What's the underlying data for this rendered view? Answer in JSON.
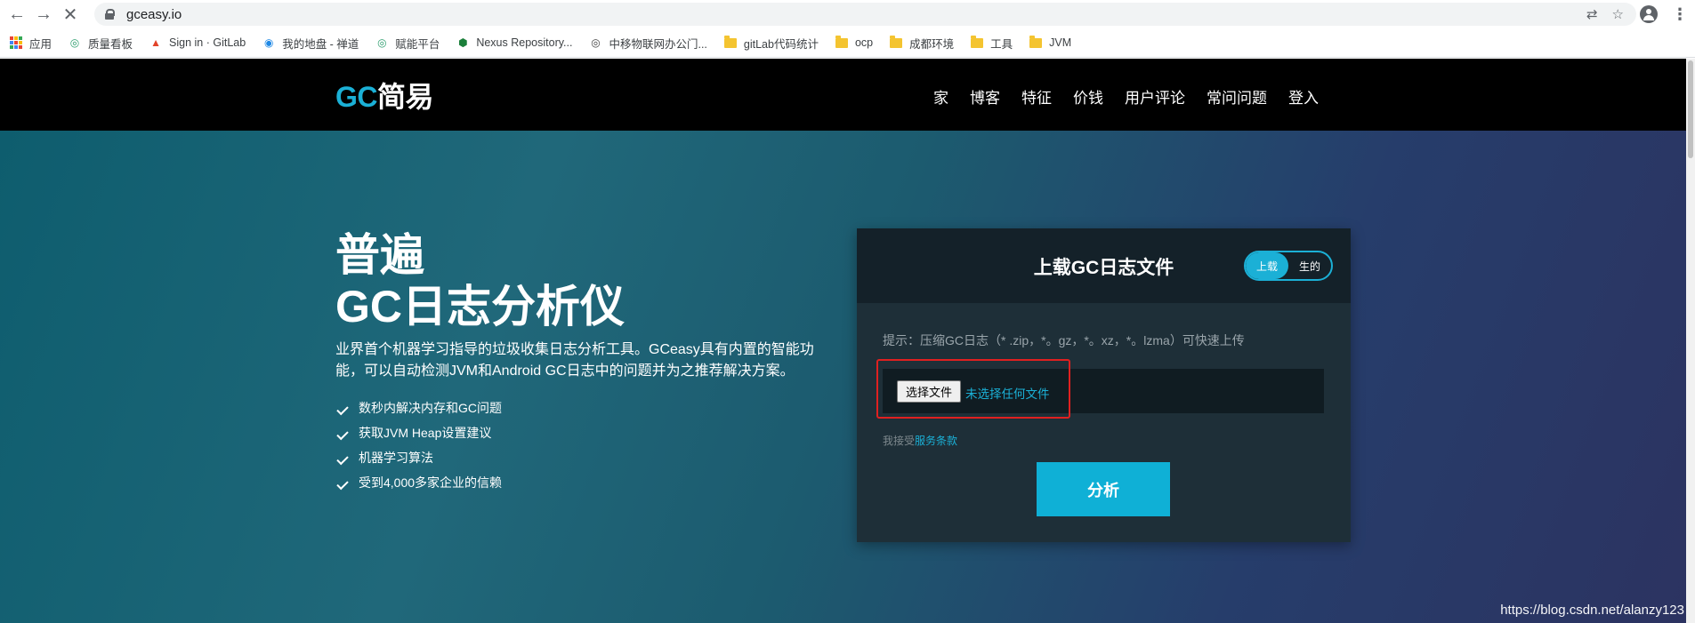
{
  "browser": {
    "url": "gceasy.io",
    "bookmarks": [
      {
        "label": "应用",
        "icon": "apps-grid-icon"
      },
      {
        "label": "质量看板",
        "icon": "globe-icon"
      },
      {
        "label": "Sign in · GitLab",
        "icon": "gitlab-icon"
      },
      {
        "label": "我的地盘 - 禅道",
        "icon": "zentao-icon"
      },
      {
        "label": "赋能平台",
        "icon": "globe-icon"
      },
      {
        "label": "Nexus Repository...",
        "icon": "nexus-icon"
      },
      {
        "label": "中移物联网办公门...",
        "icon": "globe-icon"
      },
      {
        "label": "gitLab代码统计",
        "icon": "folder-icon"
      },
      {
        "label": "ocp",
        "icon": "folder-icon"
      },
      {
        "label": "成都环境",
        "icon": "folder-icon"
      },
      {
        "label": "工具",
        "icon": "folder-icon"
      },
      {
        "label": "JVM",
        "icon": "folder-icon"
      }
    ]
  },
  "site": {
    "logo_gc": "GC",
    "logo_cn": "简易",
    "nav": [
      "家",
      "博客",
      "特征",
      "价钱",
      "用户评论",
      "常问问题",
      "登入"
    ]
  },
  "hero": {
    "title_line1": "普遍",
    "title_line2": "GC日志分析仪",
    "description": "业界首个机器学习指导的垃圾收集日志分析工具。GCeasy具有内置的智能功能，可以自动检测JVM和Android GC日志中的问题并为之推荐解决方案。",
    "features": [
      "数秒内解决内存和GC问题",
      "获取JVM Heap设置建议",
      "机器学习算法",
      "受到4,000多家企业的信赖"
    ]
  },
  "upload": {
    "title": "上载GC日志文件",
    "toggle_upload": "上载",
    "toggle_raw": "生的",
    "hint": "提示：压缩GC日志（* .zip，*。gz，*。xz，*。lzma）可快速上传",
    "choose_file": "选择文件",
    "no_file": "未选择任何文件",
    "terms_prefix": "我接受",
    "terms_link": "服务条款",
    "analyze": "分析"
  },
  "watermark": "https://blog.csdn.net/alanzy123",
  "colors": {
    "accent": "#1bb0d6",
    "header_bg": "#000000",
    "card_bg": "#1e2f38",
    "highlight_frame": "#e02020"
  }
}
